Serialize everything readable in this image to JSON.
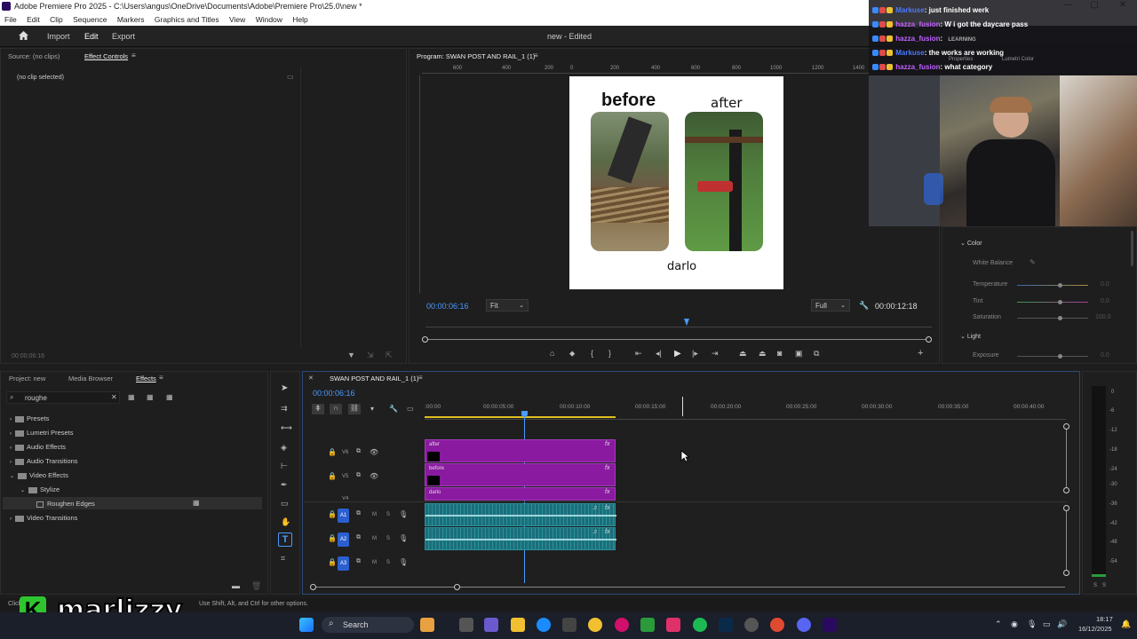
{
  "window": {
    "title": "Adobe Premiere Pro 2025 - C:\\Users\\angus\\OneDrive\\Documents\\Adobe\\Premiere Pro\\25.0\\new *"
  },
  "menu": [
    "File",
    "Edit",
    "Clip",
    "Sequence",
    "Markers",
    "Graphics and Titles",
    "View",
    "Window",
    "Help"
  ],
  "header": {
    "nav": [
      "Import",
      "Edit",
      "Export"
    ],
    "project_status": "new - Edited"
  },
  "source_panel": {
    "tab_source": "Source: (no clips)",
    "tab_effect_controls": "Effect Controls",
    "no_clip": "(no clip selected)",
    "timecode": "00:00:06:16"
  },
  "program": {
    "title": "Program: SWAN POST AND RAIL_1 (1)",
    "ruler": [
      "600",
      "400",
      "200",
      "0",
      "200",
      "400",
      "600",
      "800",
      "1000",
      "1200",
      "1400"
    ],
    "timecode": "00:00:06:16",
    "fit_label": "Fit",
    "full_label": "Full",
    "duration": "00:00:12:18",
    "frame": {
      "before": "before",
      "after": "after",
      "caption": "darlo"
    }
  },
  "project": {
    "tabs": [
      "Project: new",
      "Media Browser",
      "Effects"
    ],
    "search_value": "roughe",
    "tree": [
      {
        "label": "Presets",
        "depth": 0
      },
      {
        "label": "Lumetri Presets",
        "depth": 0
      },
      {
        "label": "Audio Effects",
        "depth": 0
      },
      {
        "label": "Audio Transitions",
        "depth": 0
      },
      {
        "label": "Video Effects",
        "depth": 0
      },
      {
        "label": "Stylize",
        "depth": 1
      },
      {
        "label": "Roughen Edges",
        "depth": 2
      },
      {
        "label": "Video Transitions",
        "depth": 0
      }
    ]
  },
  "timeline": {
    "title": "SWAN POST AND RAIL_1 (1)",
    "timecode": "00:00:06:16",
    "ruler": [
      ":00:00",
      "00:00:05:00",
      "00:00:10:00",
      "00:00:15:00",
      "00:00:20:00",
      "00:00:25:00",
      "00:00:30:00",
      "00:00:35:00",
      "00:00:40:00"
    ],
    "video_tracks": [
      "V6",
      "V5",
      "V4"
    ],
    "audio_tracks": [
      "A1",
      "A2",
      "A3"
    ],
    "clips": [
      "after",
      "before",
      "darlo"
    ],
    "track_buttons": {
      "mute": "M",
      "solo": "S"
    }
  },
  "meters": {
    "scale": [
      "0",
      "-6",
      "-12",
      "-18",
      "-24",
      "-30",
      "-36",
      "-42",
      "-48",
      "-54"
    ],
    "solo": [
      "S",
      "S"
    ]
  },
  "lumetri": {
    "properties_tab": "Properties",
    "lumetri_tab": "Lumetri Color",
    "learning": "LEARNING",
    "color_section": "Color",
    "white_balance": "White Balance",
    "temperature": "Temperature",
    "tint": "Tint",
    "saturation": "Saturation",
    "light_section": "Light",
    "exposure": "Exposure",
    "values": [
      "0.0",
      "0.0",
      "100.0",
      "0.0"
    ]
  },
  "chat": [
    {
      "user": "Markuse",
      "text": ": just finished werk",
      "color": "#4a7aff"
    },
    {
      "user": "hazza_fusion",
      "text": ": W i got the daycare pass",
      "color": "#c060ff"
    },
    {
      "user": "hazza_fusion",
      "text": ":",
      "color": "#c060ff"
    },
    {
      "user": "Markuse",
      "text": ": the works are working",
      "color": "#4a7aff"
    },
    {
      "user": "hazza_fusion",
      "text": ": what category",
      "color": "#c060ff"
    }
  ],
  "status_bar": "Use Shift, Alt, and Ctrl for other options.",
  "status_prefix": "Click",
  "watermark": "marlizzy",
  "taskbar": {
    "search": "Search",
    "time": "18:17",
    "date": "16/12/2025"
  }
}
